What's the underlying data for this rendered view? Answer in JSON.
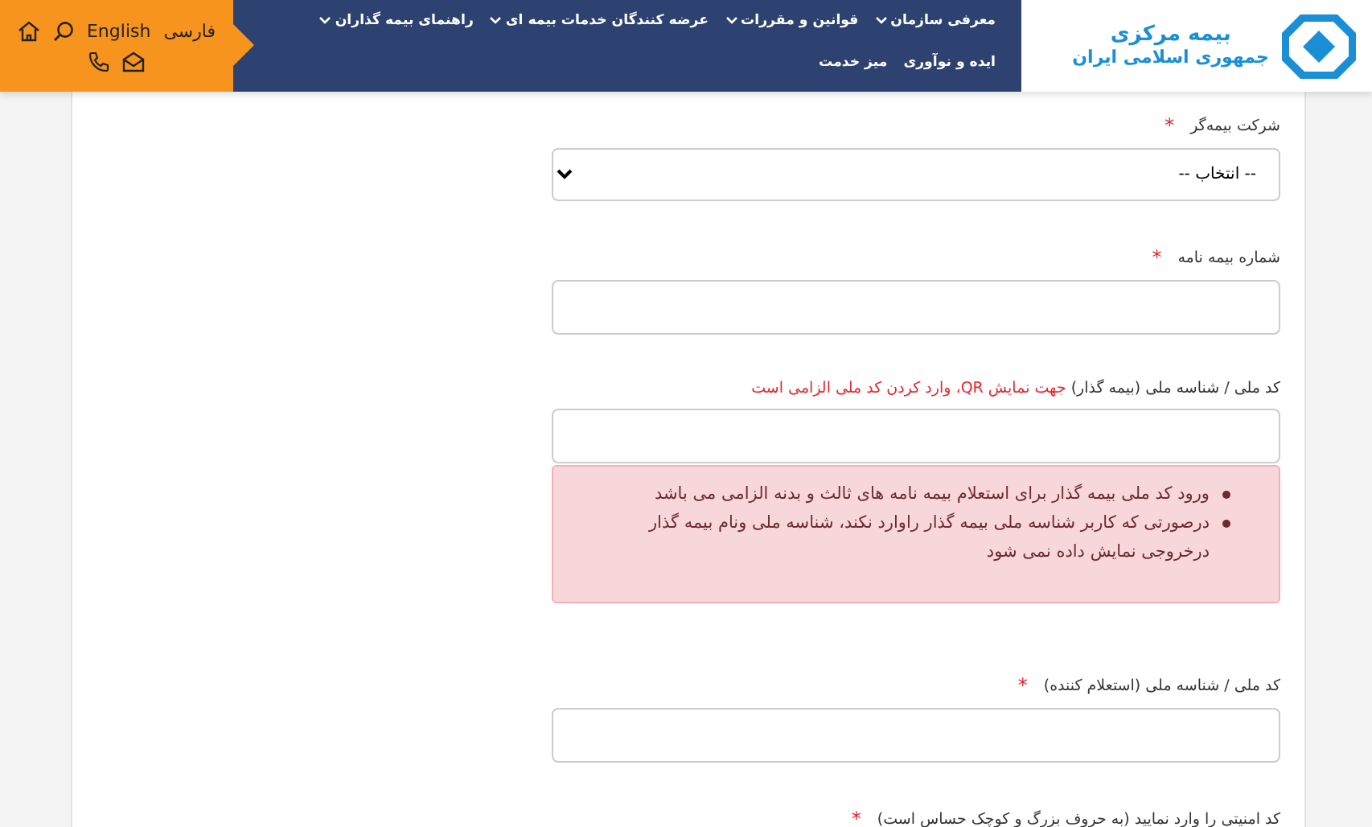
{
  "logo": {
    "line_1": "بیمه مرکزی",
    "line_2": "جمهوری اسلامی ایران"
  },
  "nav": {
    "items": [
      {
        "label": "معرفی سازمان",
        "has_submenu": true
      },
      {
        "label": "قوانین و مقررات",
        "has_submenu": true
      },
      {
        "label": "عرضه کنندگان خدمات بیمه ای",
        "has_submenu": true
      },
      {
        "label": "راهنمای بیمه گذاران",
        "has_submenu": true
      },
      {
        "label": "ایده و نوآوری",
        "has_submenu": false
      },
      {
        "label": "میز خدمت",
        "has_submenu": false
      }
    ]
  },
  "toolbar": {
    "languages": [
      {
        "label": "فارسی"
      },
      {
        "label": "English"
      }
    ]
  },
  "form": {
    "fields": [
      {
        "kind": "select",
        "label": "شرکت بیمه‌گر",
        "required_mark": "*",
        "value": "-- انتخاب --"
      },
      {
        "kind": "input",
        "label": "شماره بیمه نامه",
        "required_mark": "*"
      },
      {
        "kind": "input",
        "label": "کد ملی / شناسه ملی (بیمه گذار)",
        "note": "جهت نمایش QR، وارد کردن کد ملی الزامی است"
      },
      {
        "kind": "alert",
        "items": [
          "ورود کد ملی بیمه گذار برای استعلام بیمه نامه های ثالث و بدنه الزامی می باشد",
          "درصورتی که کاربر شناسه ملی بیمه گذار راوارد نکند، شناسه ملی ونام بیمه گذار درخروجی نمایش داده نمی شود"
        ]
      },
      {
        "kind": "input",
        "label": "کد ملی / شناسه ملی (استعلام کننده)",
        "required_mark": "*"
      },
      {
        "kind": "captcha",
        "label": "کد امنیتی را وارد نمایید (به حروف بزرگ و کوچک حساس است)",
        "required_mark": "*"
      }
    ]
  }
}
